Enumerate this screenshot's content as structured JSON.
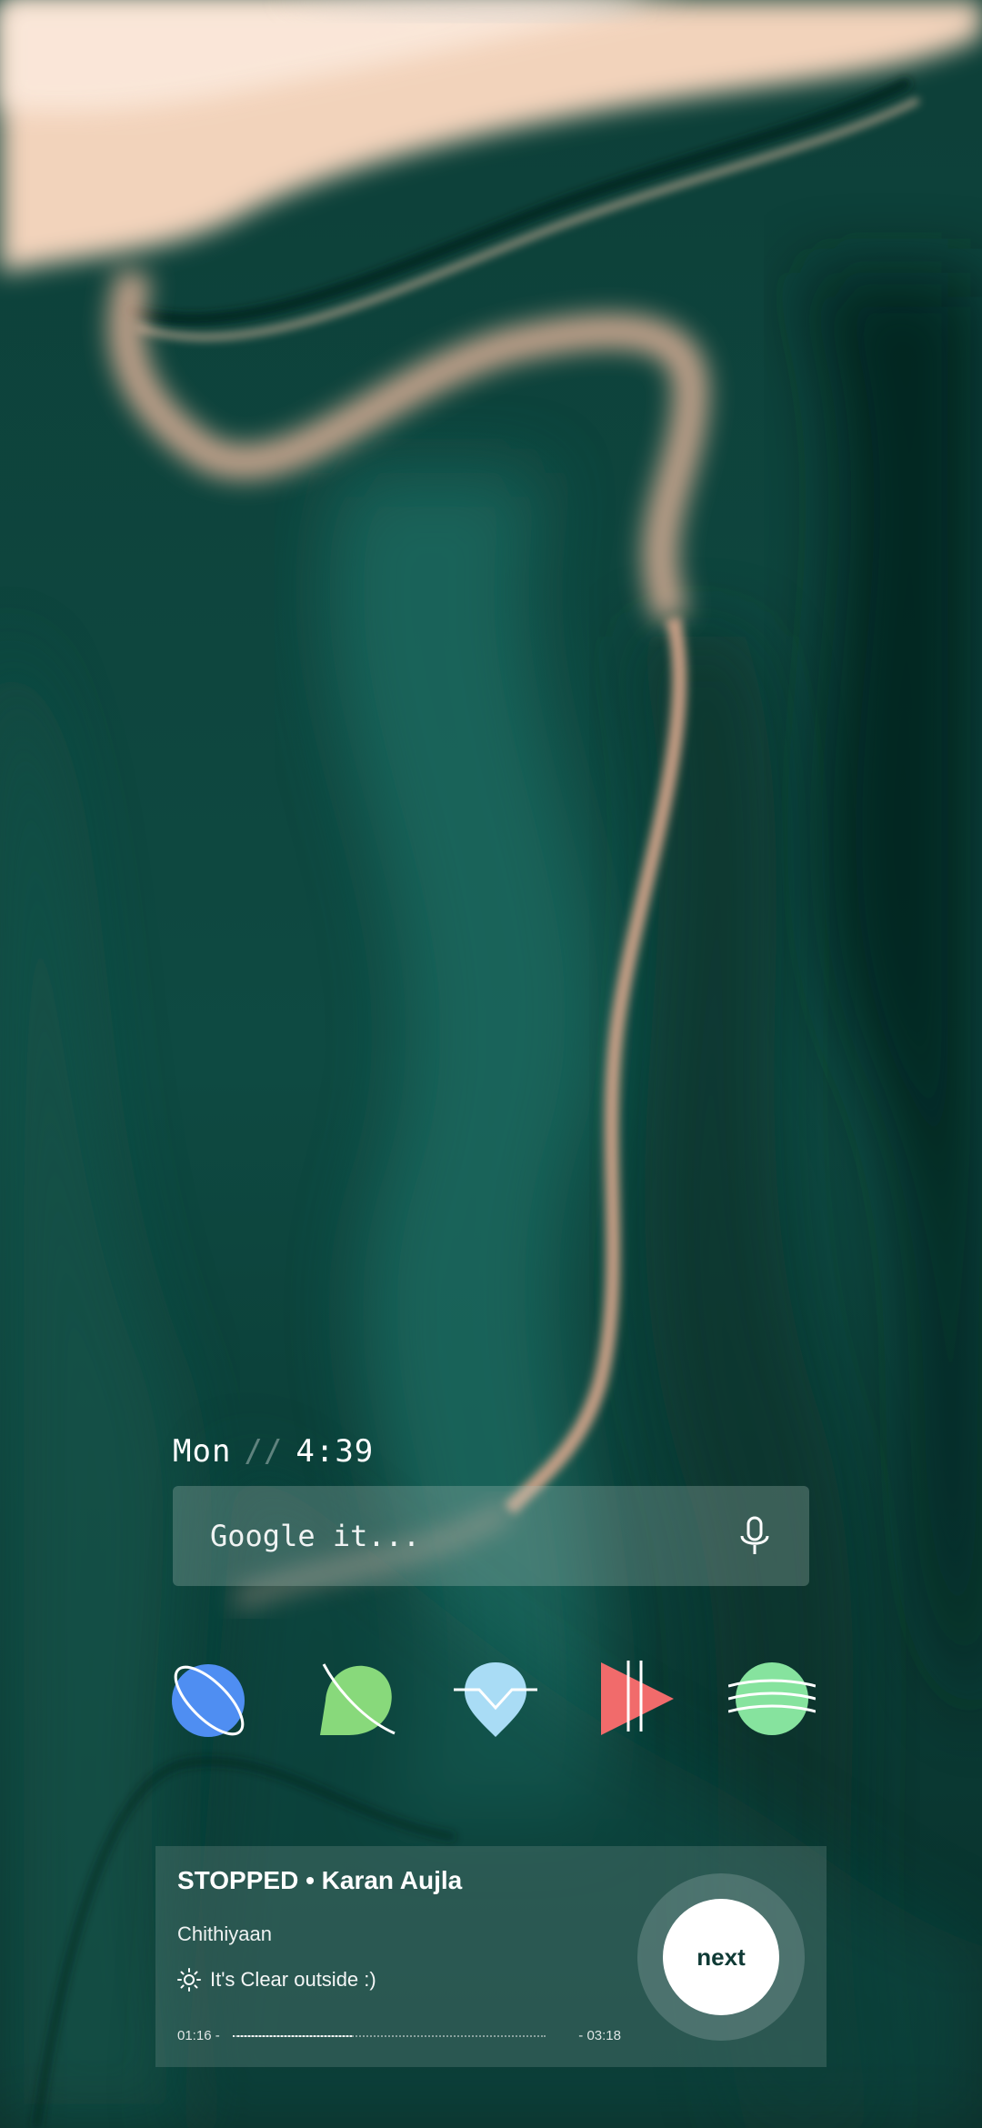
{
  "clock": {
    "day": "Mon",
    "separator": "//",
    "time": "4:39"
  },
  "search": {
    "placeholder": "Google it...",
    "mic_icon": "microphone-icon"
  },
  "dock": {
    "apps": [
      {
        "icon": "planet-icon",
        "color": "#4f8ef2"
      },
      {
        "icon": "chat-bubble-icon",
        "color": "#88d97b"
      },
      {
        "icon": "location-pin-icon",
        "color": "#a9dcf5"
      },
      {
        "icon": "play-pause-icon",
        "color": "#f16b6b"
      },
      {
        "icon": "striped-globe-icon",
        "color": "#86e39e"
      }
    ]
  },
  "music": {
    "status_line": "STOPPED • Karan Aujla",
    "song": "Chithiyaan",
    "weather": "It's Clear outside :)",
    "weather_icon": "sun-icon",
    "elapsed": "01:16 -",
    "total": "- 03:18",
    "progress_fraction": 0.38,
    "next_label": "next"
  },
  "colors": {
    "wallpaper_dark": "#0a3a34",
    "wallpaper_teal": "#1a6a60",
    "wallpaper_cream": "#f2d3bb"
  }
}
